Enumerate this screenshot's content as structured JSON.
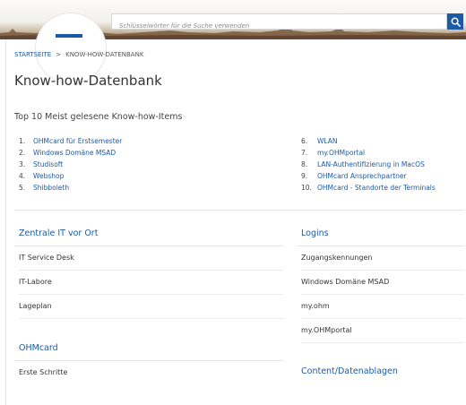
{
  "header": {
    "search_placeholder": "Schlüsselwörter für die Suche verwenden",
    "search_icon": "search-icon",
    "accent_color": "#1b5aa6"
  },
  "breadcrumb": {
    "home": "STARTSEITE",
    "separator": ">",
    "current": "KNOW-HOW-DATENBANK"
  },
  "page": {
    "title": "Know-how-Datenbank"
  },
  "top10": {
    "heading": "Top 10 Meist gelesene Know-how-Items",
    "left": [
      {
        "num": "1.",
        "label": "OHMcard für Erstsemester"
      },
      {
        "num": "2.",
        "label": "Windows Domäne MSAD"
      },
      {
        "num": "3.",
        "label": "Studisoft"
      },
      {
        "num": "4.",
        "label": "Webshop"
      },
      {
        "num": "5.",
        "label": "Shibboleth"
      }
    ],
    "right": [
      {
        "num": "6.",
        "label": "WLAN"
      },
      {
        "num": "7.",
        "label": "my.OHMportal"
      },
      {
        "num": "8.",
        "label": "LAN-Authentifizierung in MacOS"
      },
      {
        "num": "9.",
        "label": "OHMcard Ansprechpartner"
      },
      {
        "num": "10.",
        "label": "OHMcard - Standorte der Terminals"
      }
    ]
  },
  "sections": {
    "zentrale": {
      "title": "Zentrale IT vor Ort",
      "items": [
        "IT Service Desk",
        "IT-Labore",
        "Lageplan"
      ]
    },
    "ohmcard": {
      "title": "OHMcard",
      "items": [
        "Erste Schritte"
      ]
    },
    "logins": {
      "title": "Logins",
      "items": [
        "Zugangskennungen",
        "Windows Domäne MSAD",
        "my.ohm",
        "my.OHMportal"
      ]
    },
    "content": {
      "title": "Content/Datenablagen"
    }
  }
}
